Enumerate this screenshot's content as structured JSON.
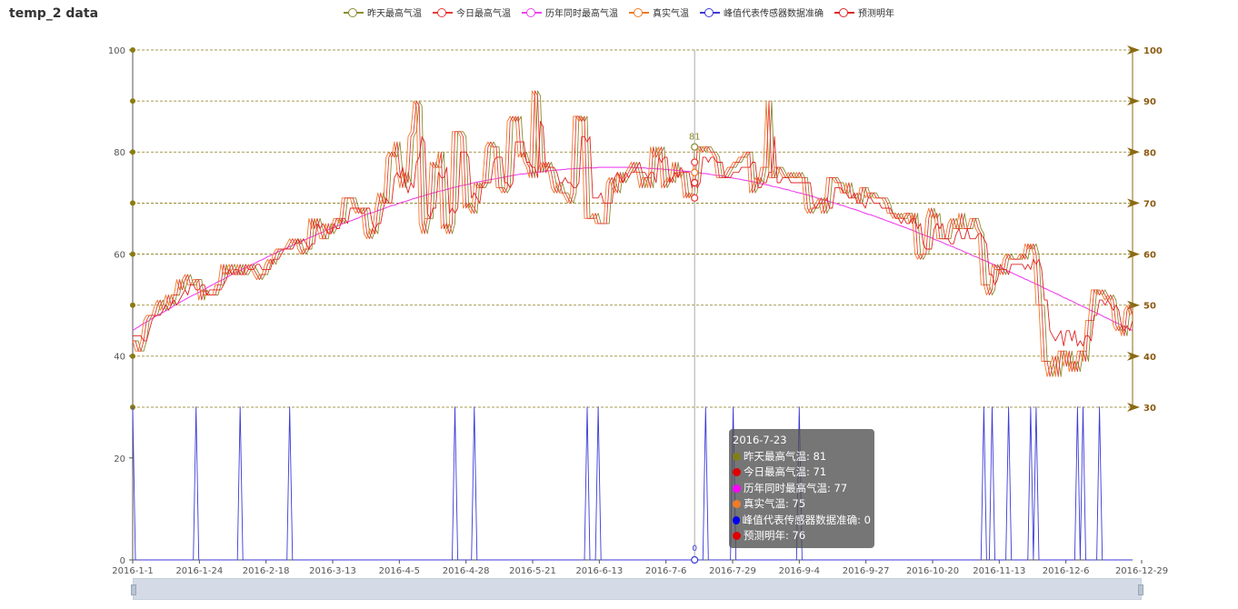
{
  "title": "temp_2 data",
  "chart_data": {
    "type": "line",
    "x_start": "2016-1-1",
    "x_end": "2016-12-29",
    "x_ticks": [
      "2016-1-1",
      "2016-1-24",
      "2016-2-18",
      "2016-3-13",
      "2016-4-5",
      "2016-4-28",
      "2016-5-21",
      "2016-6-13",
      "2016-7-6",
      "2016-7-29",
      "2016-9-4",
      "2016-9-27",
      "2016-10-20",
      "2016-11-13",
      "2016-12-6",
      "2016-12-29"
    ],
    "y_left": {
      "min": 0,
      "max": 100,
      "ticks": [
        0,
        20,
        40,
        60,
        80,
        100
      ]
    },
    "y_right": {
      "min": 30,
      "max": 100,
      "ticks": [
        30,
        40,
        50,
        60,
        70,
        80,
        90,
        100
      ]
    },
    "series": [
      {
        "name": "昨天最高气温",
        "color": "#8b8b2e",
        "values": []
      },
      {
        "name": "今日最高气温",
        "color": "#e83a3a",
        "values": []
      },
      {
        "name": "历年同时最高气温",
        "color": "#ee44ee",
        "values": []
      },
      {
        "name": "真实气温",
        "color": "#f07b2a",
        "values": []
      },
      {
        "name": "峰值代表传感器数据准确",
        "color": "#3b3bd6",
        "values": []
      },
      {
        "name": "预测明年",
        "color": "#e02424",
        "values": []
      }
    ],
    "grid": true,
    "legend_placement": "top"
  },
  "tooltip": {
    "date": "2016-7-23",
    "rows": [
      {
        "label": "昨天最高气温: 81",
        "color": "#7f7f1a"
      },
      {
        "label": "今日最高气温: 71",
        "color": "#e00000"
      },
      {
        "label": "历年同时最高气温: 77",
        "color": "#ff00ff"
      },
      {
        "label": "真实气温: 75",
        "color": "#f07b2a"
      },
      {
        "label": "峰值代表传感器数据准确: 0",
        "color": "#0000ee"
      },
      {
        "label": "预测明年: 76",
        "color": "#e00000"
      }
    ],
    "pointer_label_top": "81",
    "pointer_label_bottom": "0"
  }
}
